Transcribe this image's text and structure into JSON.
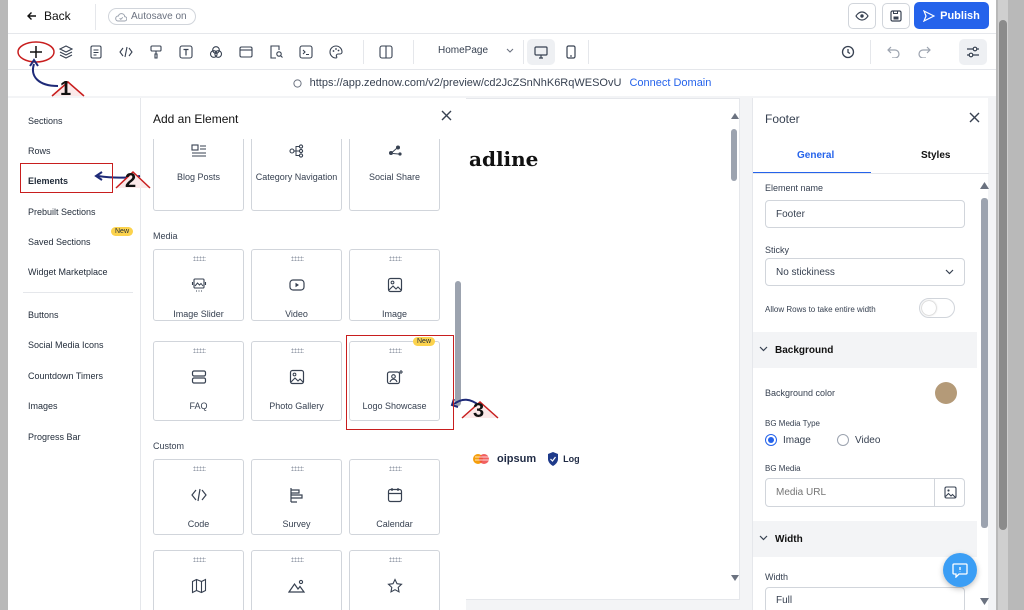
{
  "topbar": {
    "back_label": "Back",
    "autosave_label": "Autosave on",
    "publish_label": "Publish"
  },
  "toolbar": {
    "page_select": "HomePage"
  },
  "urlbar": {
    "url": "https://app.zednow.com/v2/preview/cd2JcZSnNhK6RqWESOvU",
    "connect_label": "Connect Domain"
  },
  "canvas": {
    "headline_fragment": "adline",
    "logo_text": "oipsum",
    "logo_text2": "Log"
  },
  "sidebar": {
    "items": [
      {
        "label": "Sections"
      },
      {
        "label": "Rows"
      },
      {
        "label": "Elements"
      },
      {
        "label": "Prebuilt Sections"
      },
      {
        "label": "Saved Sections",
        "badge": "New"
      },
      {
        "label": "Widget Marketplace"
      },
      {
        "label": "Buttons"
      },
      {
        "label": "Social Media Icons"
      },
      {
        "label": "Countdown Timers"
      },
      {
        "label": "Images"
      },
      {
        "label": "Progress Bar"
      }
    ]
  },
  "panel": {
    "title": "Add an Element",
    "row0": [
      "Blog Posts",
      "Category Navigation",
      "Social Share"
    ],
    "media_label": "Media",
    "media": [
      "Image Slider",
      "Video",
      "Image",
      "FAQ",
      "Photo Gallery",
      "Logo Showcase"
    ],
    "new_badge": "New",
    "custom_label": "Custom",
    "custom": [
      "Code",
      "Survey",
      "Calendar"
    ]
  },
  "rpanel": {
    "title": "Footer",
    "tab_general": "General",
    "tab_styles": "Styles",
    "element_name_label": "Element name",
    "element_name_value": "Footer",
    "sticky_label": "Sticky",
    "sticky_value": "No stickiness",
    "allow_rows_label": "Allow Rows to take entire width",
    "background_header": "Background",
    "bg_color_label": "Background color",
    "bg_color": "#b49a78",
    "bg_media_type_label": "BG Media Type",
    "radio_image": "Image",
    "radio_video": "Video",
    "bg_media_label": "BG Media",
    "media_url_placeholder": "Media URL",
    "width_header": "Width",
    "width_label": "Width",
    "width_value": "Full"
  },
  "annotations": [
    "1",
    "2",
    "3"
  ],
  "colors": {
    "accent": "#2563eb",
    "annotation": "#c81e1e"
  }
}
